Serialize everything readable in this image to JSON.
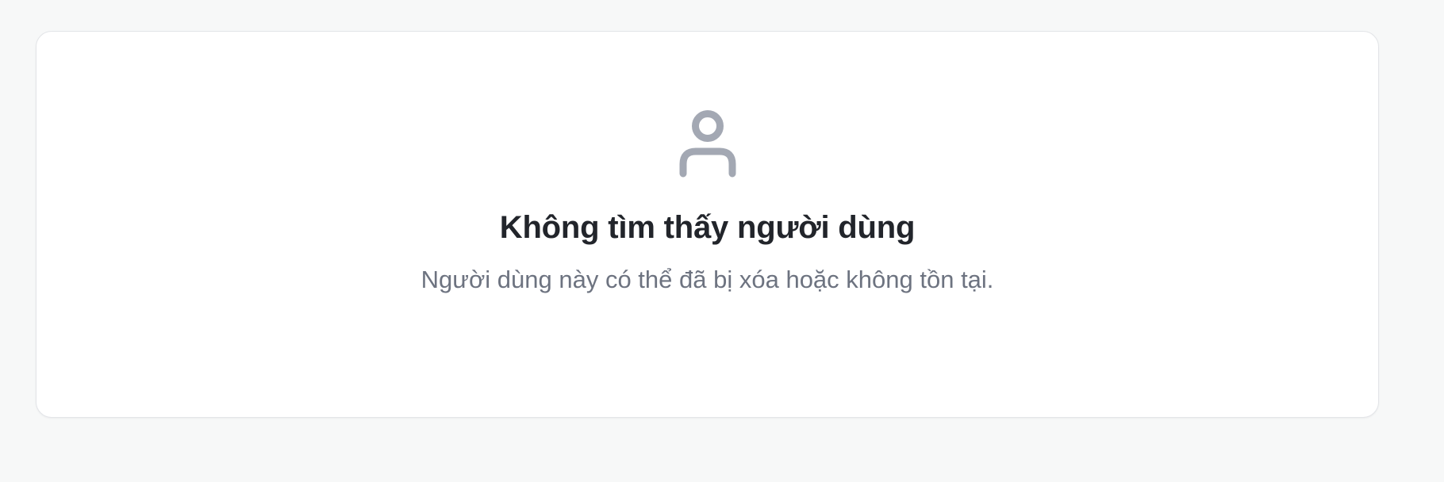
{
  "empty_state": {
    "icon": "user-icon",
    "icon_color": "#a3a8b3",
    "title": "Không tìm thấy người dùng",
    "message": "Người dùng này có thể đã bị xóa hoặc không tồn tại."
  }
}
